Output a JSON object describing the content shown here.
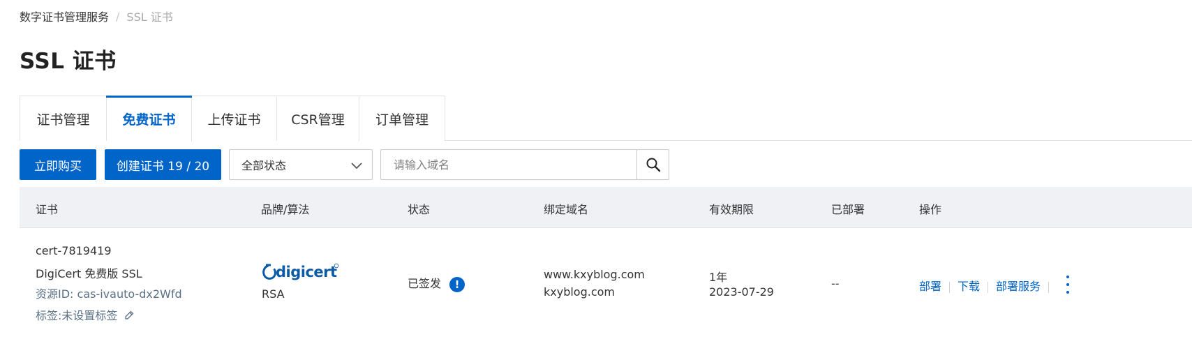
{
  "breadcrumb": {
    "root": "数字证书管理服务",
    "separator": "/",
    "current": "SSL 证书"
  },
  "page": {
    "title": "SSL 证书"
  },
  "tabs": [
    {
      "label": "证书管理",
      "active": false
    },
    {
      "label": "免费证书",
      "active": true
    },
    {
      "label": "上传证书",
      "active": false
    },
    {
      "label": "CSR管理",
      "active": false
    },
    {
      "label": "订单管理",
      "active": false
    }
  ],
  "toolbar": {
    "buy_label": "立即购买",
    "create_label": "创建证书 19 / 20",
    "status_select": {
      "value": "全部状态"
    },
    "search": {
      "placeholder": "请输入域名"
    }
  },
  "table": {
    "headers": {
      "cert": "证书",
      "brand": "品牌/算法",
      "status": "状态",
      "domains": "绑定域名",
      "validity": "有效期限",
      "deployed": "已部署",
      "actions": "操作"
    },
    "rows": [
      {
        "cert_name": "cert-7819419",
        "cert_product": "DigiCert 免费版 SSL",
        "resource_id": "资源ID: cas-ivauto-dx2Wfd",
        "tags": "标签:未设置标签",
        "brand_logo": "digicert",
        "algorithm": "RSA",
        "status": "已签发",
        "status_icon": "exclamation-circle-icon",
        "domain_1": "www.kxyblog.com",
        "domain_2": "kxyblog.com",
        "validity_period": "1年",
        "validity_date": "2023-07-29",
        "deployed": "--",
        "actions": {
          "deploy": "部署",
          "download": "下载",
          "deploy_service": "部署服务"
        }
      }
    ]
  },
  "colors": {
    "primary": "#0064c8",
    "header_bg": "#eff1f4",
    "muted_text": "#5a7086"
  }
}
